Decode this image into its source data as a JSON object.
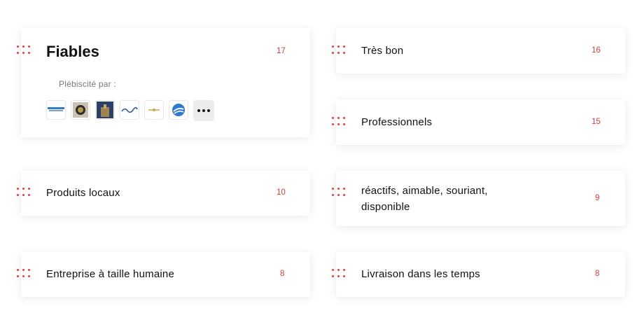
{
  "accent_color": "#e53935",
  "featured": {
    "title": "Fiables",
    "count": "17",
    "endorsed_label": "Plébiscité par :",
    "logos": [
      "trident-logo",
      "round-emblem-logo",
      "building-photo-logo",
      "script-brand-logo",
      "gold-emblem-logo",
      "blue-globe-logo"
    ],
    "more_icon": "ellipsis-icon"
  },
  "tags": [
    {
      "label": "Très bon",
      "count": "16"
    },
    {
      "label": "Professionnels",
      "count": "15"
    },
    {
      "label": "Produits locaux",
      "count": "10"
    },
    {
      "label": "réactifs, aimable, souriant, disponible",
      "count": "9"
    },
    {
      "label": "Entreprise à taille humaine",
      "count": "8"
    },
    {
      "label": "Livraison dans les temps",
      "count": "8"
    }
  ]
}
